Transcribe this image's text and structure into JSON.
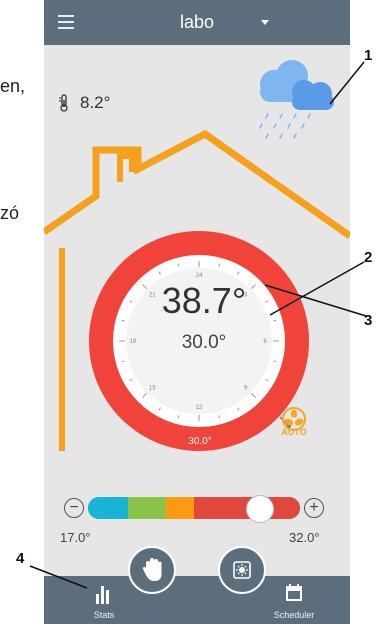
{
  "left_fragments": [
    "en,",
    "zó"
  ],
  "topbar": {
    "title": "labo",
    "menu_icon": "hamburger-icon",
    "dropdown_icon": "caret-down-icon"
  },
  "outside": {
    "temperature": "8.2°",
    "icon": "thermometer-icon",
    "weather_icon": "rain-cloud-icon"
  },
  "dial": {
    "current_temperature": "38.7°",
    "setpoint": "30.0°",
    "ring_label": "30.0°",
    "clock_ticks": [
      "21",
      "24",
      "3",
      "6",
      "9",
      "12",
      "15",
      "18"
    ]
  },
  "fan": {
    "icon": "fan-icon",
    "label": "AUTO"
  },
  "slider": {
    "min_label": "17.0°",
    "max_label": "32.0°",
    "minus_label": "−",
    "plus_label": "+",
    "value_fraction": 0.85
  },
  "colors": {
    "bar": "#5c6e7c",
    "ring": "#f0433a",
    "house": "#f7a01b",
    "cyan": "#17b6d6",
    "green": "#8bc34a",
    "orange": "#ff9a12",
    "red": "#e0483d"
  },
  "nav": {
    "stats_label": "Stats",
    "scheduler_label": "Scheduler",
    "manual_icon": "hand-icon",
    "eco_icon": "sun-icon"
  },
  "callouts": [
    "1",
    "2",
    "3",
    "4"
  ]
}
